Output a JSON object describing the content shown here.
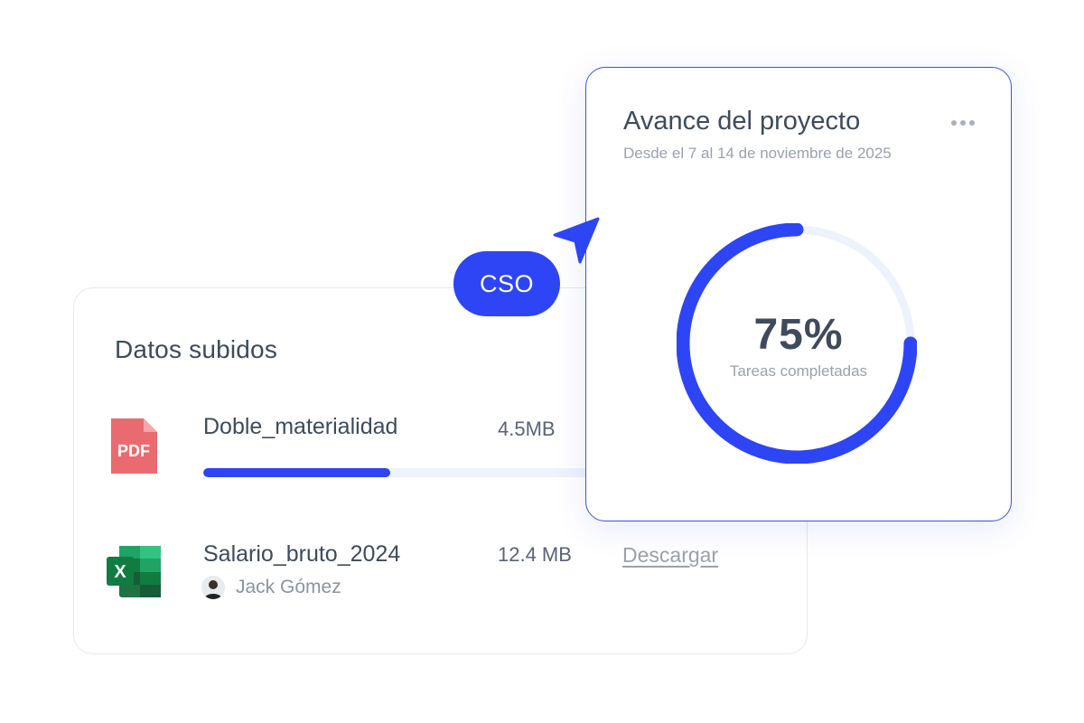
{
  "uploads_card": {
    "title": "Datos subidos",
    "files": [
      {
        "name": "Doble_materialidad",
        "size": "4.5MB",
        "type_icon": "pdf-file-icon",
        "icon_label": "PDF",
        "upload_progress": 0.47
      },
      {
        "name": "Salario_bruto_2024",
        "size": "12.4 MB",
        "type_icon": "excel-file-icon",
        "icon_label": "X",
        "owner": "Jack Gómez",
        "action": "Descargar"
      }
    ]
  },
  "project_card": {
    "title": "Avance del proyecto",
    "subtitle": "Desde el 7 al 14 de noviembre de 2025",
    "menu_icon": "more-horizontal-icon",
    "progress_percent": 75,
    "progress_label": "75%",
    "caption": "Tareas completadas"
  },
  "collaborator_tag": {
    "label": "CSO",
    "icon": "cursor-pointer-icon"
  },
  "colors": {
    "accent": "#2d45f5",
    "text_dark": "#3f4a5c",
    "text_muted": "#9aa1ad",
    "track": "#eef2fb",
    "pdf": "#ea6b6f",
    "excel": "#1f7244"
  }
}
